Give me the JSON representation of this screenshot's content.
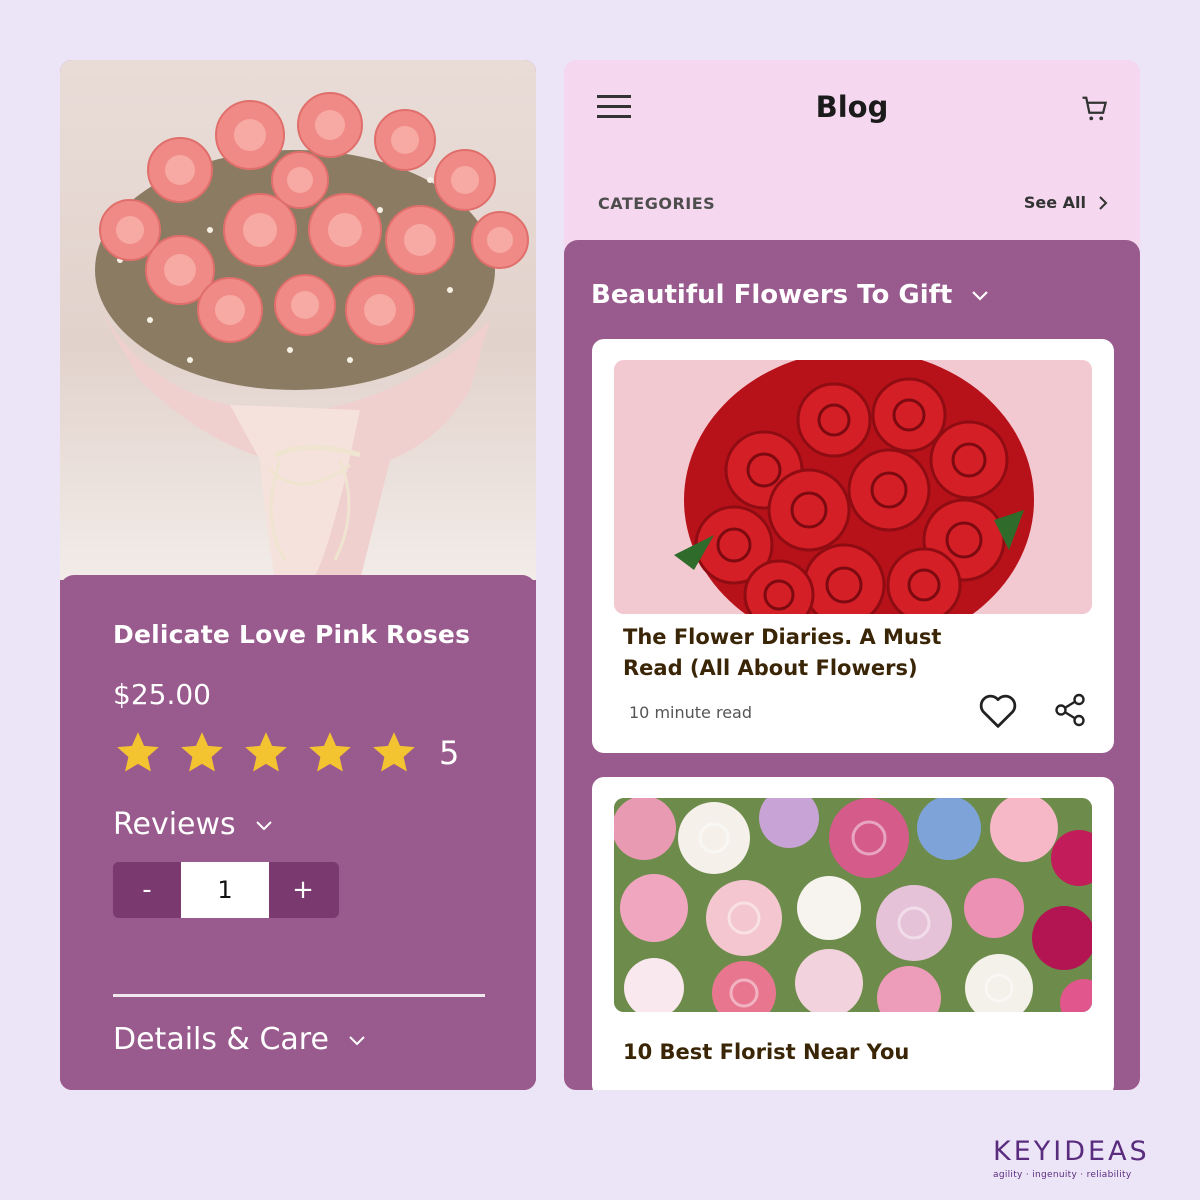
{
  "product": {
    "image_alt": "pink carnation bouquet",
    "title": "Delicate Love Pink Roses",
    "price": "$25.00",
    "rating": {
      "stars": 5,
      "value": "5"
    },
    "reviews_label": "Reviews",
    "quantity": {
      "minus": "-",
      "value": "1",
      "plus": "+"
    },
    "details_label": "Details & Care"
  },
  "blog": {
    "title": "Blog",
    "categories_label": "CATEGORIES",
    "see_all_label": "See All",
    "section_title": "Beautiful Flowers To Gift",
    "posts": [
      {
        "title": "The Flower Diaries. A Must Read (All About Flowers)",
        "meta": "10 minute read"
      },
      {
        "title": "10 Best Florist Near You"
      }
    ]
  },
  "brand": {
    "name": "KEYIDEAS",
    "tagline": "agility  ·  ingenuity  ·  reliability"
  },
  "colors": {
    "background": "#ece5f8",
    "card_purple": "#995a8d",
    "header_pink": "#f5d8ef",
    "star_yellow": "#f4c430",
    "brand_purple": "#5a2c7e"
  },
  "icons": [
    "menu-icon",
    "cart-icon",
    "chevron-down-icon",
    "chevron-right-icon",
    "star-icon",
    "heart-icon",
    "share-icon"
  ]
}
